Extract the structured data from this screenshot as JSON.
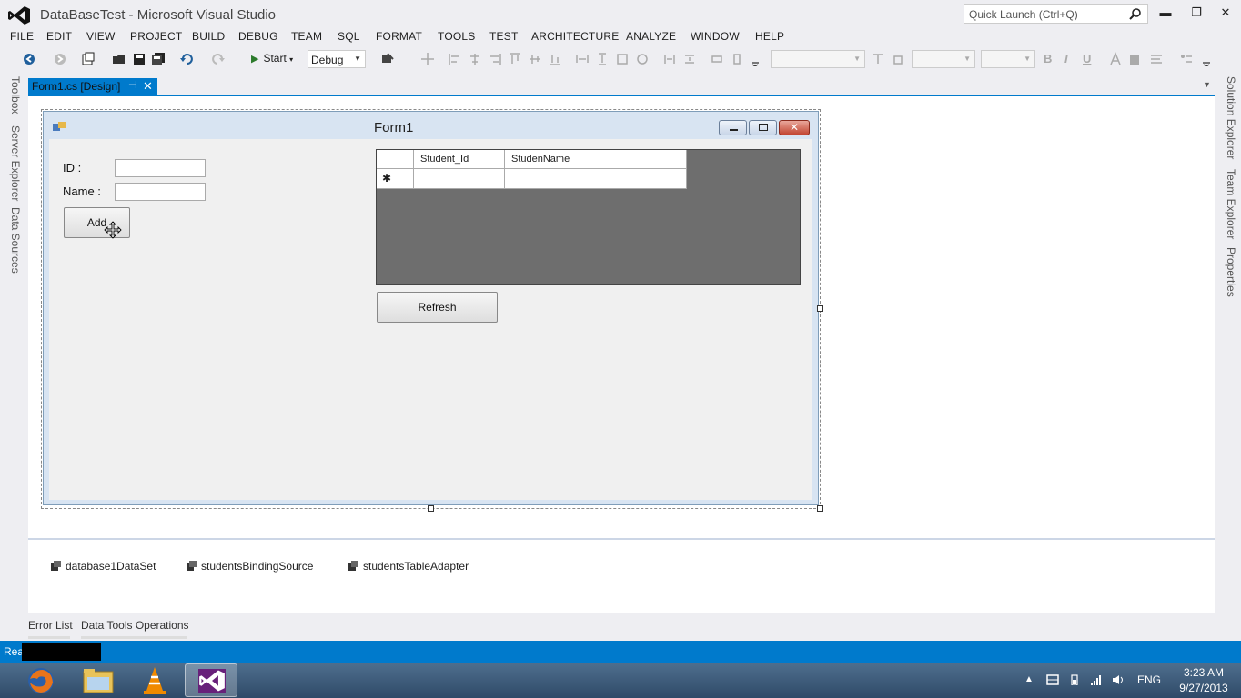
{
  "window": {
    "title": "DataBaseTest - Microsoft Visual Studio"
  },
  "quick_launch": {
    "placeholder": "Quick Launch (Ctrl+Q)"
  },
  "menu": [
    "FILE",
    "EDIT",
    "VIEW",
    "PROJECT",
    "BUILD",
    "DEBUG",
    "TEAM",
    "SQL",
    "FORMAT",
    "TOOLS",
    "TEST",
    "ARCHITECTURE",
    "ANALYZE",
    "WINDOW",
    "HELP"
  ],
  "toolbar": {
    "start_label": "Start",
    "config": "Debug",
    "bold": "B",
    "italic": "I",
    "underline": "U"
  },
  "left_tabs": [
    "Toolbox",
    "Server Explorer",
    "Data Sources"
  ],
  "right_tabs": [
    "Solution Explorer",
    "Team Explorer",
    "Properties"
  ],
  "document_tab": {
    "label": "Form1.cs [Design]",
    "pin": "⊣",
    "close": "✕"
  },
  "form": {
    "title": "Form1",
    "id_label": "ID :",
    "name_label": "Name :",
    "add_button": "Add",
    "refresh_button": "Refresh",
    "grid": {
      "columns": [
        "Student_Id",
        "StudenName"
      ],
      "new_row_marker": "✱"
    }
  },
  "component_tray": [
    "database1DataSet",
    "studentsBindingSource",
    "studentsTableAdapter"
  ],
  "bottom_tabs": [
    "Error List",
    "Data Tools Operations"
  ],
  "status": {
    "text": "Rea"
  },
  "taskbar": {
    "language": "ENG",
    "time": "3:23 AM",
    "date": "9/27/2013"
  },
  "colors": {
    "accent": "#007acc",
    "taskbar": "#3a5878",
    "grid_bg": "#6e6e6e"
  }
}
